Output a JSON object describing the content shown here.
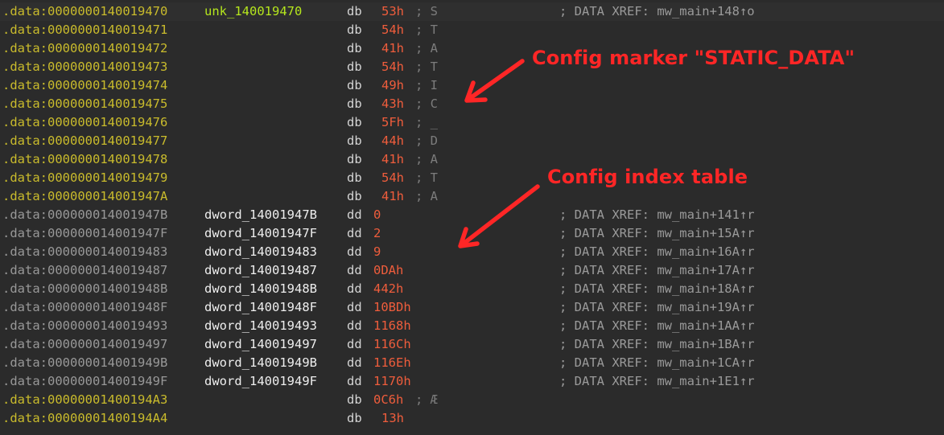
{
  "disassembly": {
    "rows": [
      {
        "seg": ".data:",
        "addr": "0000000140019470",
        "addr_color": "#c9bb2c",
        "label": "unk_140019470",
        "label_kind": "ascii",
        "mnemonic": "db",
        "operand": "53h",
        "op_kind": "byte",
        "char": "; S",
        "comment": "; DATA XREF: mw_main+148↑o"
      },
      {
        "seg": ".data:",
        "addr": "0000000140019471",
        "addr_color": "#c9bb2c",
        "label": "",
        "mnemonic": "db",
        "operand": "54h",
        "op_kind": "byte",
        "char": "; T",
        "comment": ""
      },
      {
        "seg": ".data:",
        "addr": "0000000140019472",
        "addr_color": "#c9bb2c",
        "label": "",
        "mnemonic": "db",
        "operand": "41h",
        "op_kind": "byte",
        "char": "; A",
        "comment": ""
      },
      {
        "seg": ".data:",
        "addr": "0000000140019473",
        "addr_color": "#c9bb2c",
        "label": "",
        "mnemonic": "db",
        "operand": "54h",
        "op_kind": "byte",
        "char": "; T",
        "comment": ""
      },
      {
        "seg": ".data:",
        "addr": "0000000140019474",
        "addr_color": "#c9bb2c",
        "label": "",
        "mnemonic": "db",
        "operand": "49h",
        "op_kind": "byte",
        "char": "; I",
        "comment": ""
      },
      {
        "seg": ".data:",
        "addr": "0000000140019475",
        "addr_color": "#c9bb2c",
        "label": "",
        "mnemonic": "db",
        "operand": "43h",
        "op_kind": "byte",
        "char": "; C",
        "comment": ""
      },
      {
        "seg": ".data:",
        "addr": "0000000140019476",
        "addr_color": "#c9bb2c",
        "label": "",
        "mnemonic": "db",
        "operand": "5Fh",
        "op_kind": "byte",
        "char": "; _",
        "comment": ""
      },
      {
        "seg": ".data:",
        "addr": "0000000140019477",
        "addr_color": "#c9bb2c",
        "label": "",
        "mnemonic": "db",
        "operand": "44h",
        "op_kind": "byte",
        "char": "; D",
        "comment": ""
      },
      {
        "seg": ".data:",
        "addr": "0000000140019478",
        "addr_color": "#c9bb2c",
        "label": "",
        "mnemonic": "db",
        "operand": "41h",
        "op_kind": "byte",
        "char": "; A",
        "comment": ""
      },
      {
        "seg": ".data:",
        "addr": "0000000140019479",
        "addr_color": "#c9bb2c",
        "label": "",
        "mnemonic": "db",
        "operand": "54h",
        "op_kind": "byte",
        "char": "; T",
        "comment": ""
      },
      {
        "seg": ".data:",
        "addr": "000000014001947A",
        "addr_color": "#c9bb2c",
        "label": "",
        "mnemonic": "db",
        "operand": "41h",
        "op_kind": "byte",
        "char": "; A",
        "comment": ""
      },
      {
        "seg": ".data:",
        "addr": "000000014001947B",
        "addr_color": "#989898",
        "label": "dword_14001947B",
        "label_kind": "dword",
        "mnemonic": "dd",
        "operand": "0",
        "op_kind": "dword",
        "char": "",
        "comment": "; DATA XREF: mw_main+141↑r"
      },
      {
        "seg": ".data:",
        "addr": "000000014001947F",
        "addr_color": "#989898",
        "label": "dword_14001947F",
        "label_kind": "dword",
        "mnemonic": "dd",
        "operand": "2",
        "op_kind": "dword",
        "char": "",
        "comment": "; DATA XREF: mw_main+15A↑r"
      },
      {
        "seg": ".data:",
        "addr": "0000000140019483",
        "addr_color": "#989898",
        "label": "dword_140019483",
        "label_kind": "dword",
        "mnemonic": "dd",
        "operand": "9",
        "op_kind": "dword",
        "char": "",
        "comment": "; DATA XREF: mw_main+16A↑r"
      },
      {
        "seg": ".data:",
        "addr": "0000000140019487",
        "addr_color": "#989898",
        "label": "dword_140019487",
        "label_kind": "dword",
        "mnemonic": "dd",
        "operand": "0DAh",
        "op_kind": "dword",
        "char": "",
        "comment": "; DATA XREF: mw_main+17A↑r"
      },
      {
        "seg": ".data:",
        "addr": "000000014001948B",
        "addr_color": "#989898",
        "label": "dword_14001948B",
        "label_kind": "dword",
        "mnemonic": "dd",
        "operand": "442h",
        "op_kind": "dword",
        "char": "",
        "comment": "; DATA XREF: mw_main+18A↑r"
      },
      {
        "seg": ".data:",
        "addr": "000000014001948F",
        "addr_color": "#989898",
        "label": "dword_14001948F",
        "label_kind": "dword",
        "mnemonic": "dd",
        "operand": "10BDh",
        "op_kind": "dword",
        "char": "",
        "comment": "; DATA XREF: mw_main+19A↑r"
      },
      {
        "seg": ".data:",
        "addr": "0000000140019493",
        "addr_color": "#989898",
        "label": "dword_140019493",
        "label_kind": "dword",
        "mnemonic": "dd",
        "operand": "1168h",
        "op_kind": "dword",
        "char": "",
        "comment": "; DATA XREF: mw_main+1AA↑r"
      },
      {
        "seg": ".data:",
        "addr": "0000000140019497",
        "addr_color": "#989898",
        "label": "dword_140019497",
        "label_kind": "dword",
        "mnemonic": "dd",
        "operand": "116Ch",
        "op_kind": "dword",
        "char": "",
        "comment": "; DATA XREF: mw_main+1BA↑r"
      },
      {
        "seg": ".data:",
        "addr": "000000014001949B",
        "addr_color": "#989898",
        "label": "dword_14001949B",
        "label_kind": "dword",
        "mnemonic": "dd",
        "operand": "116Eh",
        "op_kind": "dword",
        "char": "",
        "comment": "; DATA XREF: mw_main+1CA↑r"
      },
      {
        "seg": ".data:",
        "addr": "000000014001949F",
        "addr_color": "#989898",
        "label": "dword_14001949F",
        "label_kind": "dword",
        "mnemonic": "dd",
        "operand": "1170h",
        "op_kind": "dword",
        "char": "",
        "comment": "; DATA XREF: mw_main+1E1↑r"
      },
      {
        "seg": ".data:",
        "addr": "00000001400194A3",
        "addr_color": "#c9bb2c",
        "label": "",
        "mnemonic": "db",
        "operand": "0C6h",
        "op_kind": "dword",
        "char": "; Æ",
        "comment": ""
      },
      {
        "seg": ".data:",
        "addr": "00000001400194A4",
        "addr_color": "#c9bb2c",
        "label": "",
        "mnemonic": "db",
        "operand": "13h",
        "op_kind": "byte",
        "char": "",
        "comment": ""
      }
    ]
  },
  "annotations": {
    "marker_text": "Config marker \"STATIC_DATA\"",
    "table_text": "Config index table",
    "color": "#ff2626"
  }
}
